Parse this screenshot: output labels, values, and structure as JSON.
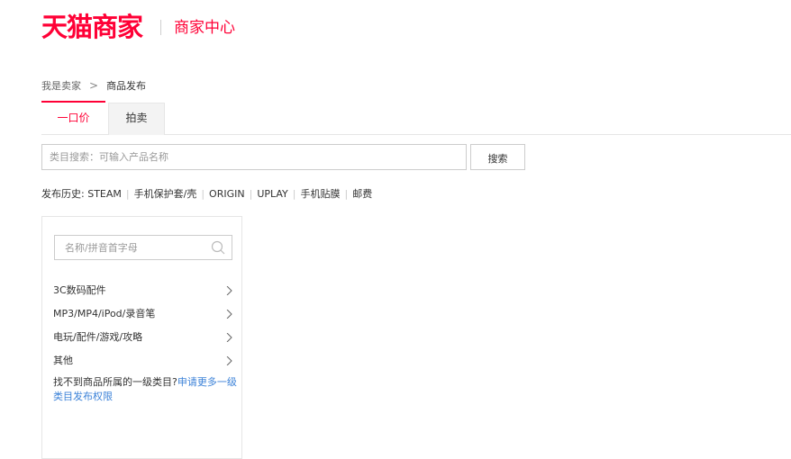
{
  "header": {
    "logo_text": "天猫商家",
    "subtitle": "商家中心",
    "brand_color": "#ff0036"
  },
  "breadcrumb": {
    "root": "我是卖家",
    "separator": ">",
    "current": "商品发布"
  },
  "tabs": [
    {
      "label": "一口价",
      "active": true
    },
    {
      "label": "拍卖",
      "active": false
    }
  ],
  "search": {
    "value": "",
    "placeholder": "类目搜索：可输入产品名称",
    "button_label": "搜索"
  },
  "history": {
    "label": "发布历史:",
    "items": [
      "STEAM",
      "手机保护套/壳",
      "ORIGIN",
      "UPLAY",
      "手机贴膜",
      "邮费"
    ]
  },
  "category_panel": {
    "search_placeholder": "名称/拼音首字母",
    "search_icon": "search-icon",
    "items": [
      {
        "label": "3C数码配件"
      },
      {
        "label": "MP3/MP4/iPod/录音笔"
      },
      {
        "label": "电玩/配件/游戏/攻略"
      },
      {
        "label": "其他"
      }
    ],
    "notice_text": "找不到商品所属的一级类目?",
    "notice_link": "申请更多一级类目发布权限",
    "link_color": "#3c82d8"
  }
}
